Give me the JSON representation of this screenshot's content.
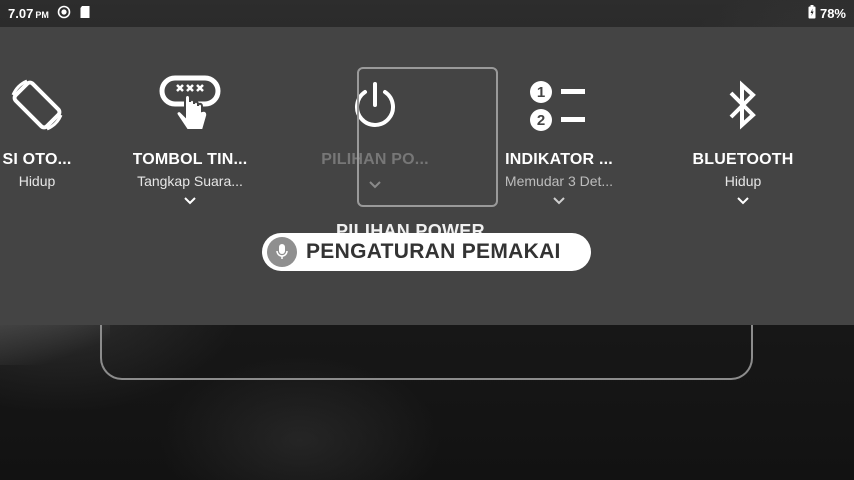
{
  "status_bar": {
    "time": "7.07",
    "ampm": "PM",
    "battery": "78%"
  },
  "tiles": [
    {
      "title": "SI OTO...",
      "subtitle": "Hidup",
      "icon": "auto-rotate-icon"
    },
    {
      "title": "TOMBOL TIN...",
      "subtitle": "Tangkap Suara...",
      "icon": "tap-gesture-icon"
    },
    {
      "title": "PILIHAN PO...",
      "subtitle": "",
      "icon": "power-icon"
    },
    {
      "title": "INDIKATOR ...",
      "subtitle": "Memudar 3 Det...",
      "icon": "numbered-list-icon"
    },
    {
      "title": "BLUETOOTH",
      "subtitle": "Hidup",
      "icon": "bluetooth-icon"
    }
  ],
  "background_label": "PILIHAN POWER",
  "voice_chip": {
    "text": "PENGATURAN PEMAKAI",
    "icon": "mic-icon"
  },
  "colors": {
    "panel": "#444444",
    "chip": "#ffffff",
    "mic_bg": "#8f8f8f"
  }
}
